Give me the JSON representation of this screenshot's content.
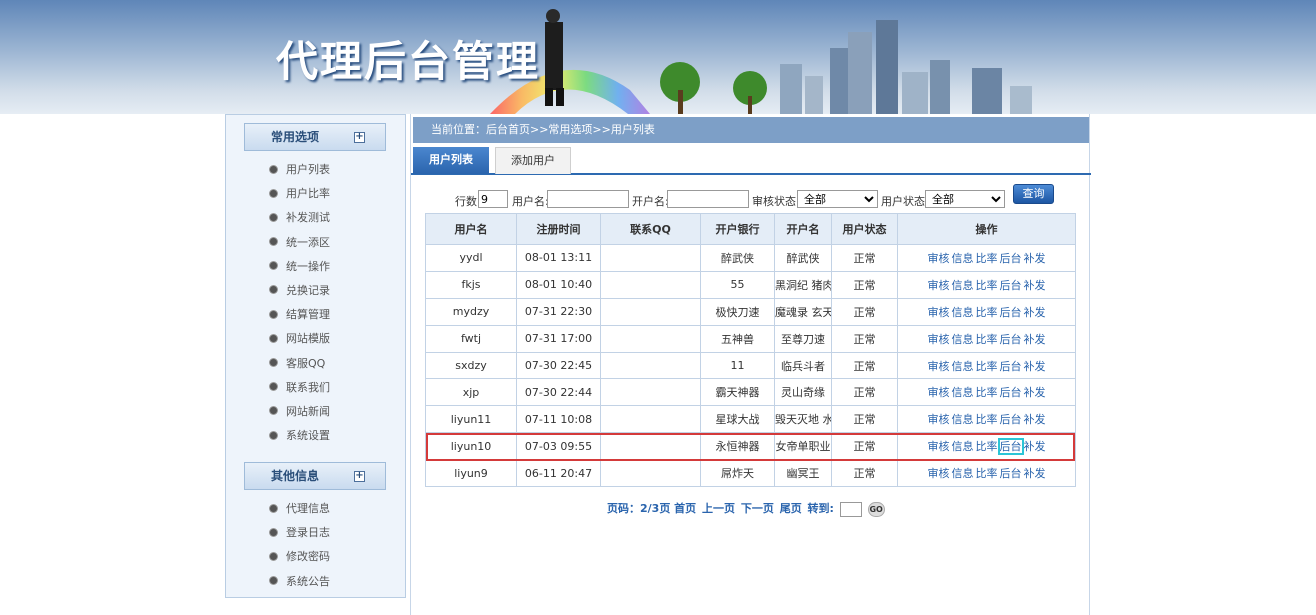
{
  "banner": {
    "title": "代理后台管理"
  },
  "sidebar": {
    "section1": {
      "title": "常用选项",
      "toggle": "+"
    },
    "items1": [
      "用户列表",
      "用户比率",
      "补发测试",
      "统一添区",
      "统一操作",
      "兑换记录",
      "结算管理",
      "网站模版",
      "客服QQ",
      "联系我们",
      "网站新闻",
      "系统设置"
    ],
    "section2": {
      "title": "其他信息",
      "toggle": "+"
    },
    "items2": [
      "代理信息",
      "登录日志",
      "修改密码",
      "系统公告"
    ]
  },
  "breadcrumb": "当前位置：后台首页>>常用选项>>用户列表",
  "tabs": {
    "active": "用户列表",
    "other": "添加用户"
  },
  "filters": {
    "rows_label": "行数:",
    "rows_value": "9",
    "username_label": "用户名:",
    "username_value": "",
    "opener_label": "开户名:",
    "opener_value": "",
    "audit_label": "审核状态:",
    "audit_value": "全部",
    "status_label": "用户状态:",
    "status_value": "全部",
    "query_label": "查询"
  },
  "table": {
    "headers": [
      "用户名",
      "注册时间",
      "联系QQ",
      "开户银行",
      "开户名",
      "用户状态",
      "操作"
    ],
    "actions": [
      "审核",
      "信息",
      "比率",
      "后台",
      "补发"
    ],
    "rows": [
      [
        "yydl",
        "08-01 13:11",
        "",
        "醉武侠",
        "醉武侠",
        "正常"
      ],
      [
        "fkjs",
        "08-01 10:40",
        "",
        "55",
        "黑洞纪 猪肉",
        "正常"
      ],
      [
        "mydzy",
        "07-31 22:30",
        "",
        "极快刀速",
        "魔魂录 玄天",
        "正常"
      ],
      [
        "fwtj",
        "07-31 17:00",
        "",
        "五神兽",
        "至尊刀速",
        "正常"
      ],
      [
        "sxdzy",
        "07-30 22:45",
        "",
        "11",
        "临兵斗者",
        "正常"
      ],
      [
        "xjp",
        "07-30 22:44",
        "",
        "霸天神器",
        "灵山奇缘",
        "正常"
      ],
      [
        "liyun11",
        "07-11 10:08",
        "",
        "星球大战",
        "毁天灭地 水",
        "正常"
      ],
      [
        "liyun10",
        "07-03 09:55",
        "",
        "永恒神器",
        "女帝单职业",
        "正常"
      ],
      [
        "liyun9",
        "06-11 20:47",
        "",
        "屌炸天",
        "幽冥王",
        "正常"
      ]
    ]
  },
  "pager": {
    "label": "页码：",
    "pages": "2/3页",
    "first": "首页",
    "prev": "上一页",
    "next": "下一页",
    "last": "尾页",
    "goto": "转到:",
    "go": "GO"
  }
}
